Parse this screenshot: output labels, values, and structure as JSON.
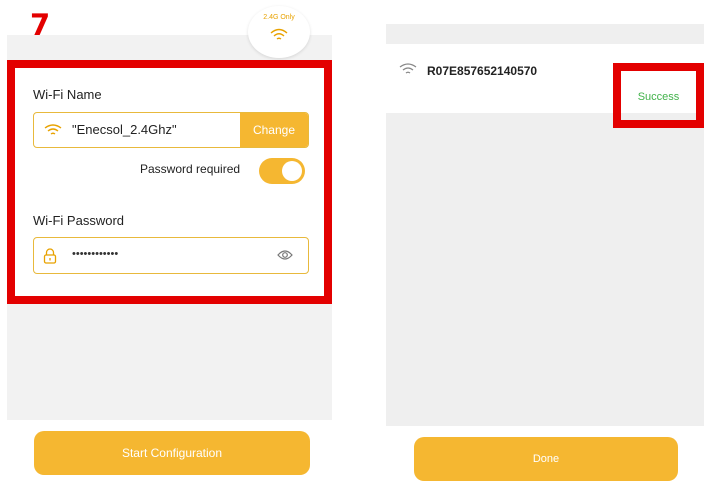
{
  "left": {
    "step_number": "7",
    "band_badge": "2.4G Only",
    "wifi_name_label": "Wi-Fi Name",
    "ssid_value": "\"Enecsol_2.4Ghz\"",
    "change_label": "Change",
    "password_required_label": "Password required",
    "password_required_on": true,
    "wifi_password_label": "Wi-Fi Password",
    "password_masked": "••••••••••••",
    "start_button_label": "Start Configuration"
  },
  "right": {
    "device_name": "R07E857652140570",
    "status": "Success",
    "done_button_label": "Done"
  },
  "colors": {
    "accent": "#f5b731",
    "highlight_frame": "#e30000",
    "success": "#41b24a"
  },
  "icons": [
    "wifi-icon",
    "lock-icon",
    "eye-icon"
  ]
}
